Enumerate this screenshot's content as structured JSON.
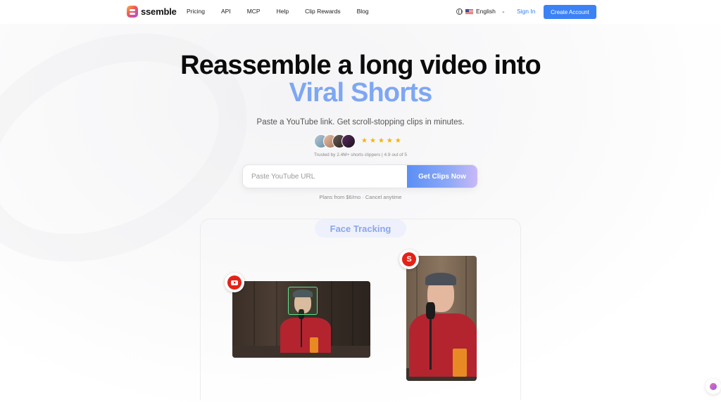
{
  "brand": {
    "name": "ssemble"
  },
  "nav": {
    "links": [
      "Pricing",
      "API",
      "MCP",
      "Help",
      "Clip Rewards",
      "Blog"
    ],
    "language": "English",
    "sign_in": "Sign In",
    "create_account": "Create Account"
  },
  "hero": {
    "title_line1": "Reassemble a long video into",
    "title_line2": "Viral Shorts",
    "subtitle": "Paste a YouTube link. Get scroll-stopping clips in minutes.",
    "trusted": "Trusted by 2.4M+ shorts clippers | 4.9 out of 5",
    "rating": 5,
    "search_placeholder": "Paste YouTube URL",
    "cta": "Get Clips Now",
    "plans": "Plans from $6/mo · Cancel anytime"
  },
  "demo": {
    "feature_label": "Face Tracking",
    "source_icon": "youtube-icon",
    "output_icon": "shorts-icon"
  },
  "colors": {
    "accent": "#3b82f6",
    "highlight": "#7ea7f3",
    "star": "#f5b400",
    "youtube_red": "#e62117",
    "tracking_green": "#62e28a"
  }
}
